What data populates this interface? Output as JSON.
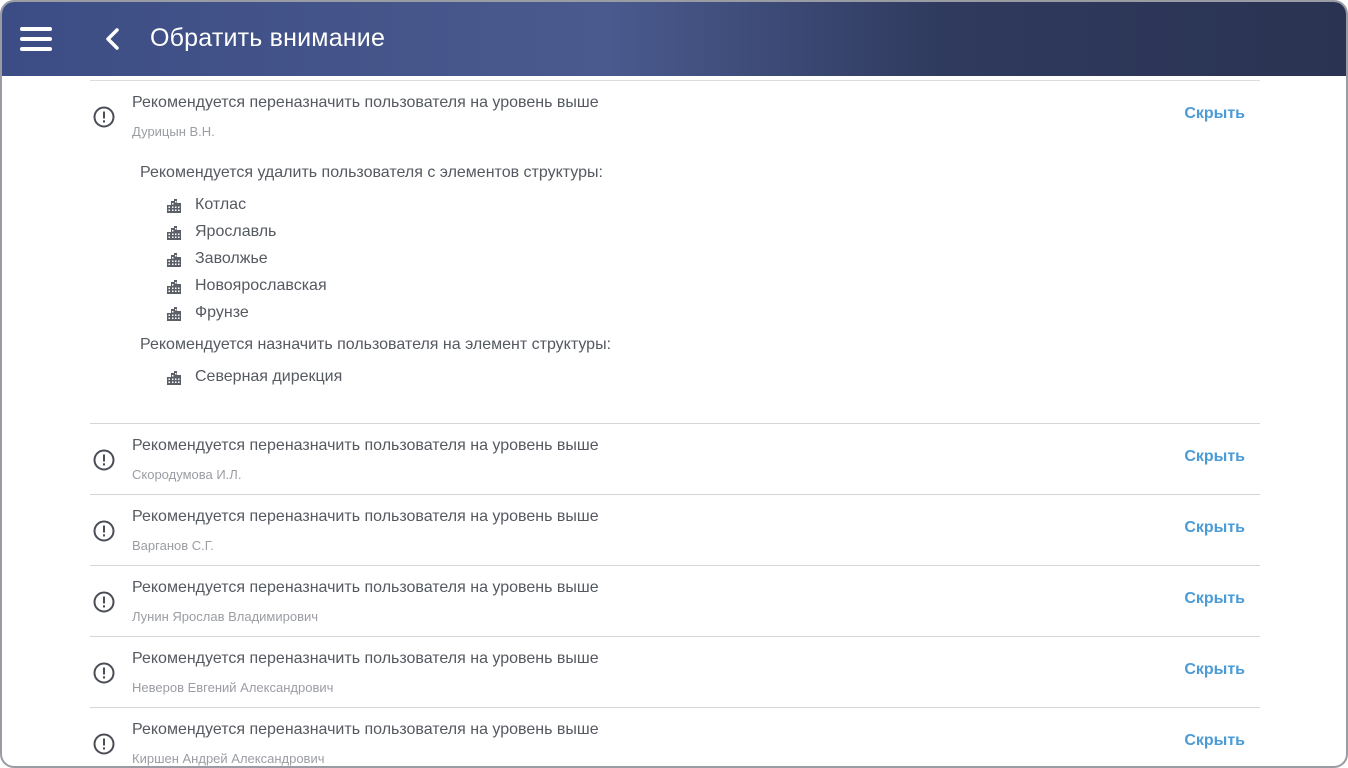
{
  "header": {
    "title": "Обратить внимание",
    "menu_icon": "hamburger-menu-icon",
    "back_icon": "chevron-left-icon"
  },
  "colors": {
    "header_start": "#3c4d85",
    "header_end": "#2b3352",
    "link": "#4a9bd6",
    "text": "#555960",
    "muted": "#9a9da3"
  },
  "hide_label": "Скрыть",
  "expanded": {
    "title": "Рекомендуется переназначить пользователя на уровень выше",
    "user": "Дурицын В.Н.",
    "remove_label": "Рекомендуется удалить пользователя с элементов структуры:",
    "remove_items": [
      "Котлас",
      "Ярославль",
      "Заволжье",
      "Новоярославская",
      "Фрунзе"
    ],
    "assign_label": "Рекомендуется назначить пользователя на элемент структуры:",
    "assign_items": [
      "Северная дирекция"
    ]
  },
  "items": [
    {
      "title": "Рекомендуется переназначить пользователя на уровень выше",
      "user": "Скородумова И.Л."
    },
    {
      "title": "Рекомендуется переназначить пользователя на уровень выше",
      "user": "Варганов С.Г."
    },
    {
      "title": "Рекомендуется переназначить пользователя на уровень выше",
      "user": "Лунин Ярослав Владимирович"
    },
    {
      "title": "Рекомендуется переназначить пользователя на уровень выше",
      "user": "Неверов Евгений Александрович"
    },
    {
      "title": "Рекомендуется переназначить пользователя на уровень выше",
      "user": "Киршен Андрей Александрович"
    }
  ]
}
